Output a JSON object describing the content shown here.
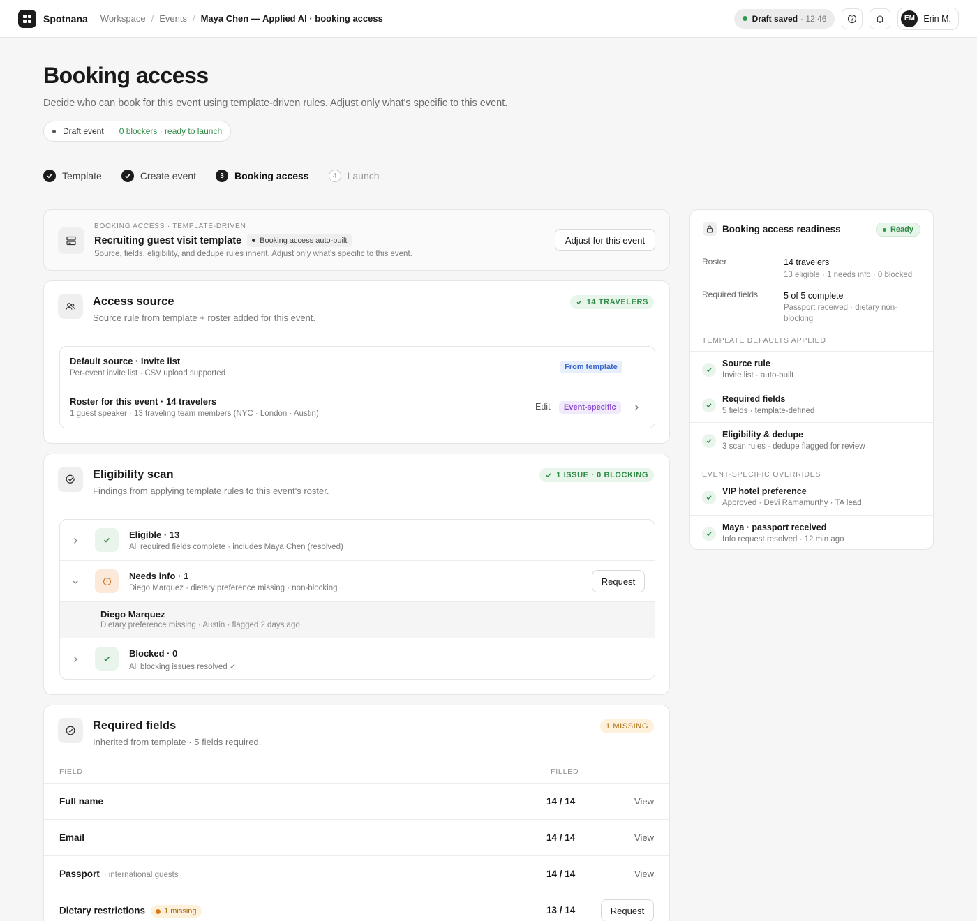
{
  "topbar": {
    "brand": "Spotnana",
    "breadcrumbs": [
      "Workspace",
      "Events",
      "Maya Chen — Applied AI · booking access"
    ],
    "draft_status": "Draft saved",
    "draft_time": "· 12:46",
    "user_initials": "EM",
    "user_name": "Erin M."
  },
  "header": {
    "title": "Booking access",
    "subtitle": "Decide who can book for this event using template-driven rules. Adjust only what's specific to this event.",
    "status_label": "Draft event",
    "status_detail": "0 blockers · ready to launch"
  },
  "steps": [
    {
      "label": "Template",
      "num": "",
      "state": "done"
    },
    {
      "label": "Create event",
      "num": "",
      "state": "done"
    },
    {
      "label": "Booking access",
      "num": "3",
      "state": "active"
    },
    {
      "label": "Launch",
      "num": "4",
      "state": "future"
    }
  ],
  "template_card": {
    "eyebrow": "BOOKING ACCESS · TEMPLATE-DRIVEN",
    "title": "Recruiting guest visit template",
    "chip": "Booking access auto-built",
    "description": "Source, fields, eligibility, and dedupe rules inherit. Adjust only what's specific to this event.",
    "button": "Adjust for this event"
  },
  "access_source": {
    "title": "Access source",
    "subtitle": "Source rule from template + roster added for this event.",
    "badge": "14 TRAVELERS",
    "rows": [
      {
        "title": "Default source · Invite list",
        "sub": "Per-event invite list · CSV upload supported",
        "tag": "From template"
      },
      {
        "title": "Roster for this event · 14 travelers",
        "sub": "1 guest speaker · 13 traveling team members (NYC · London · Austin)",
        "edit": "Edit",
        "tag": "Event-specific"
      }
    ]
  },
  "eligibility": {
    "title": "Eligibility scan",
    "subtitle": "Findings from applying template rules to this event's roster.",
    "badge": "1 ISSUE · 0 BLOCKING",
    "rows": [
      {
        "title": "Eligible · 13",
        "sub": "All required fields complete · includes Maya Chen (resolved)"
      },
      {
        "title": "Needs info · 1",
        "sub": "Diego Marquez · dietary preference missing · non-blocking",
        "button": "Request"
      },
      {
        "title": "Blocked · 0",
        "sub": "All blocking issues resolved ✓"
      }
    ],
    "expanded": {
      "name": "Diego Marquez",
      "detail": "Dietary preference missing · Austin · flagged 2 days ago"
    }
  },
  "required_fields": {
    "title": "Required fields",
    "subtitle": "Inherited from template · 5 fields required.",
    "badge": "1 MISSING",
    "col_field": "FIELD",
    "col_filled": "FILLED",
    "rows": [
      {
        "name": "Full name",
        "note": "",
        "filled": "14 / 14",
        "action": "View"
      },
      {
        "name": "Email",
        "note": "",
        "filled": "14 / 14",
        "action": "View"
      },
      {
        "name": "Passport",
        "note": "· international guests",
        "filled": "14 / 14",
        "action": "View"
      },
      {
        "name": "Dietary restrictions",
        "note": "",
        "chip": "1 missing",
        "filled": "13 / 14",
        "action": "Request"
      }
    ]
  },
  "readiness": {
    "title": "Booking access readiness",
    "badge": "Ready",
    "roster_label": "Roster",
    "roster_value": "14 travelers",
    "roster_sub": "13 eligible · 1 needs info · 0 blocked",
    "fields_label": "Required fields",
    "fields_value": "5 of 5 complete",
    "fields_sub": "Passport received · dietary non-blocking",
    "defaults_eyebrow": "TEMPLATE DEFAULTS APPLIED",
    "defaults": [
      {
        "title": "Source rule",
        "sub": "Invite list · auto-built"
      },
      {
        "title": "Required fields",
        "sub": "5 fields · template-defined"
      },
      {
        "title": "Eligibility & dedupe",
        "sub": "3 scan rules · dedupe flagged for review"
      }
    ],
    "overrides_eyebrow": "EVENT-SPECIFIC OVERRIDES",
    "overrides": [
      {
        "title": "VIP hotel preference",
        "sub": "Approved · Devi Ramamurthy · TA lead"
      },
      {
        "title": "Maya · passport received",
        "sub": "Info request resolved · 12 min ago"
      }
    ]
  }
}
